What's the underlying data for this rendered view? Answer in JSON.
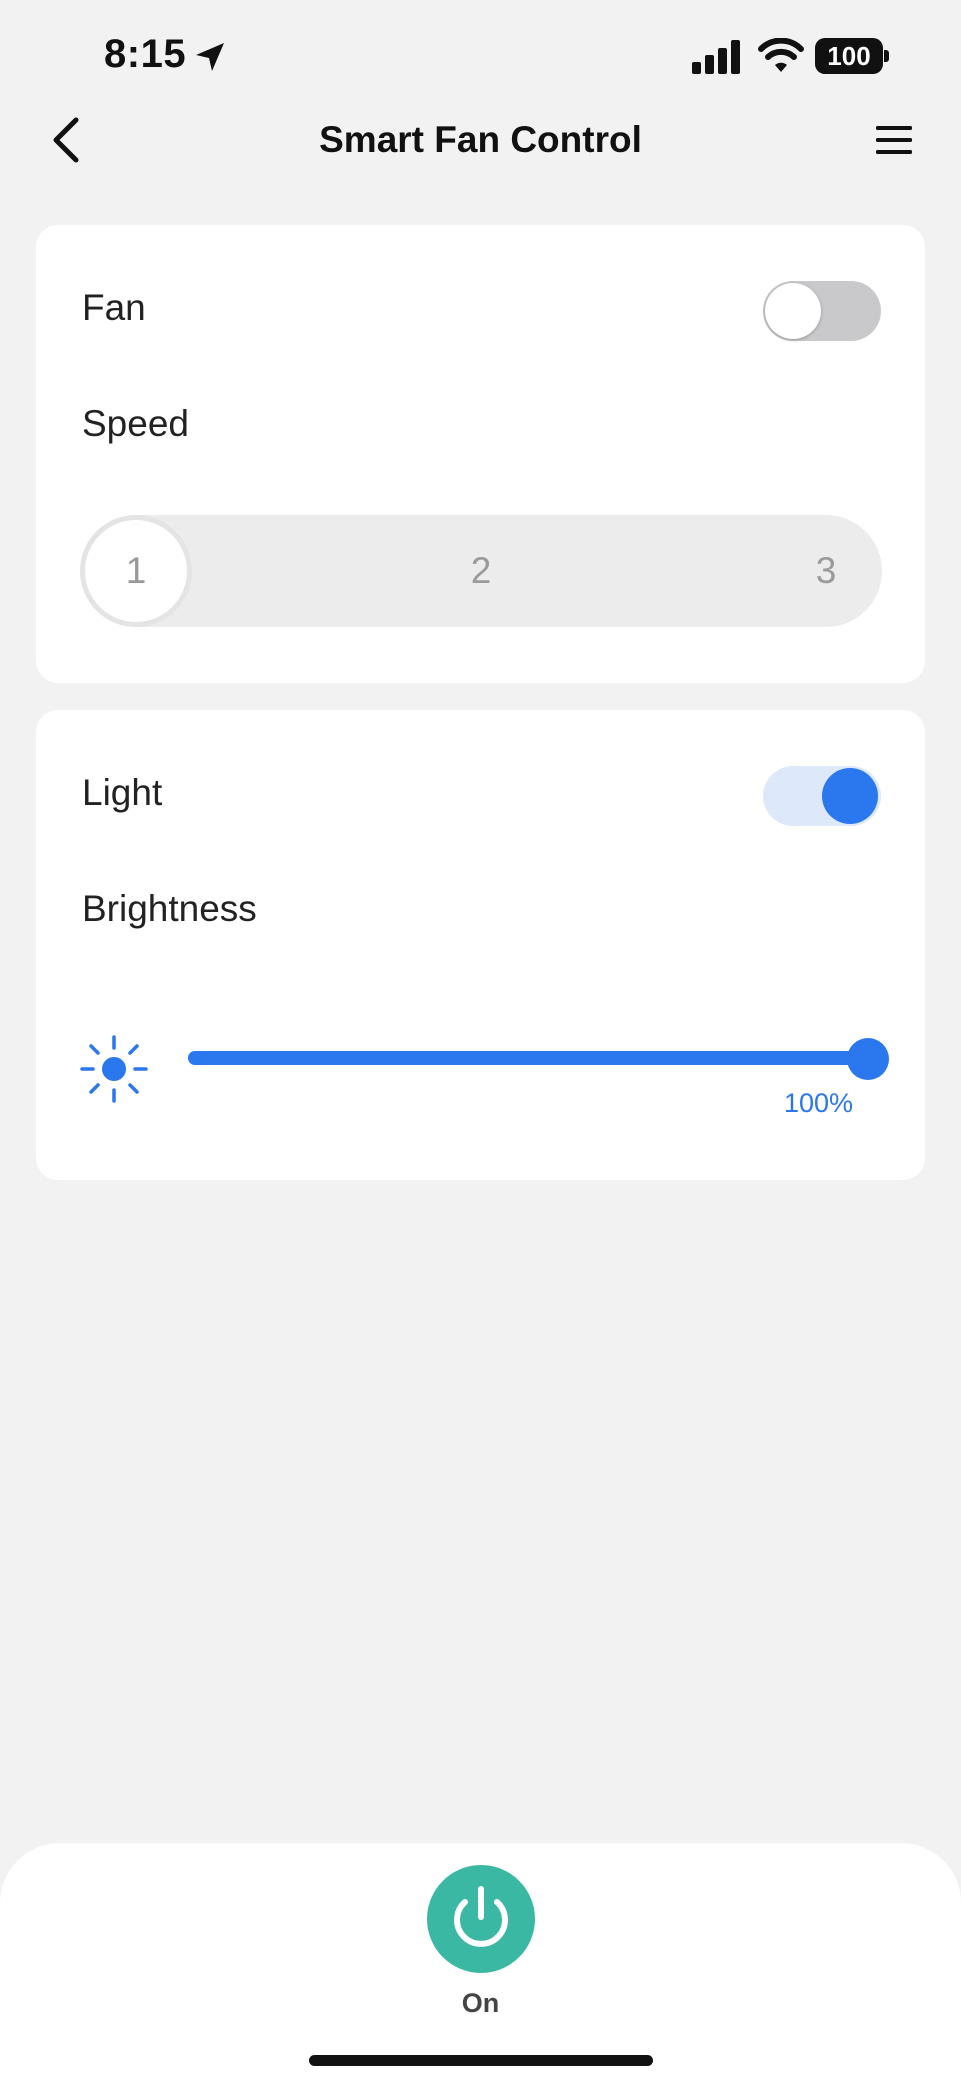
{
  "status_bar": {
    "time": "8:15",
    "battery": "100",
    "icons": [
      "location-arrow-icon",
      "cellular-signal-icon",
      "wifi-icon",
      "battery-icon"
    ]
  },
  "nav": {
    "title": "Smart Fan Control",
    "back_icon": "chevron-left-icon",
    "menu_icon": "hamburger-menu-icon"
  },
  "fan_card": {
    "label": "Fan",
    "toggle_on": false,
    "speed_label": "Speed",
    "speed_options": [
      "1",
      "2",
      "3"
    ],
    "speed_selected": "1"
  },
  "light_card": {
    "label": "Light",
    "toggle_on": true,
    "brightness_label": "Brightness",
    "brightness_icon": "sun-icon",
    "brightness_value": "100%",
    "brightness_level": 1.0
  },
  "bottom": {
    "power_icon": "power-icon",
    "power_label": "On"
  },
  "colors": {
    "accent": "#2a77ee",
    "power": "#3bb8a4",
    "background": "#f2f2f3"
  }
}
